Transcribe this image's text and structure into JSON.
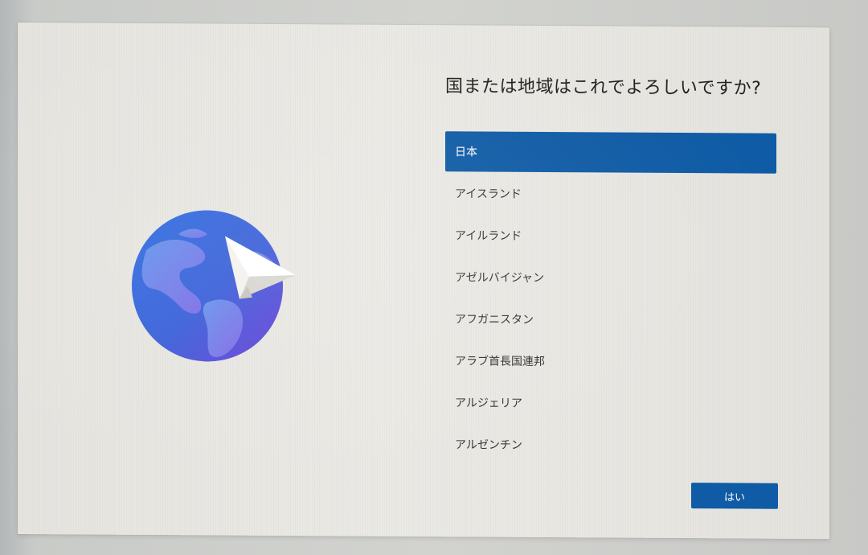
{
  "setup": {
    "title": "国または地域はこれでよろしいですか?",
    "countries": [
      {
        "label": "日本",
        "selected": true
      },
      {
        "label": "アイスランド",
        "selected": false
      },
      {
        "label": "アイルランド",
        "selected": false
      },
      {
        "label": "アゼルバイジャン",
        "selected": false
      },
      {
        "label": "アフガニスタン",
        "selected": false
      },
      {
        "label": "アラブ首長国連邦",
        "selected": false
      },
      {
        "label": "アルジェリア",
        "selected": false
      },
      {
        "label": "アルゼンチン",
        "selected": false
      }
    ],
    "yes_button_label": "はい"
  },
  "colors": {
    "accent": "#0f5ba5",
    "panel_background": "#ebe9e4",
    "globe_blue": "#2d6fd6",
    "globe_purple": "#6a3fd6"
  },
  "icons": {
    "illustration": "globe-with-paper-plane-icon"
  }
}
